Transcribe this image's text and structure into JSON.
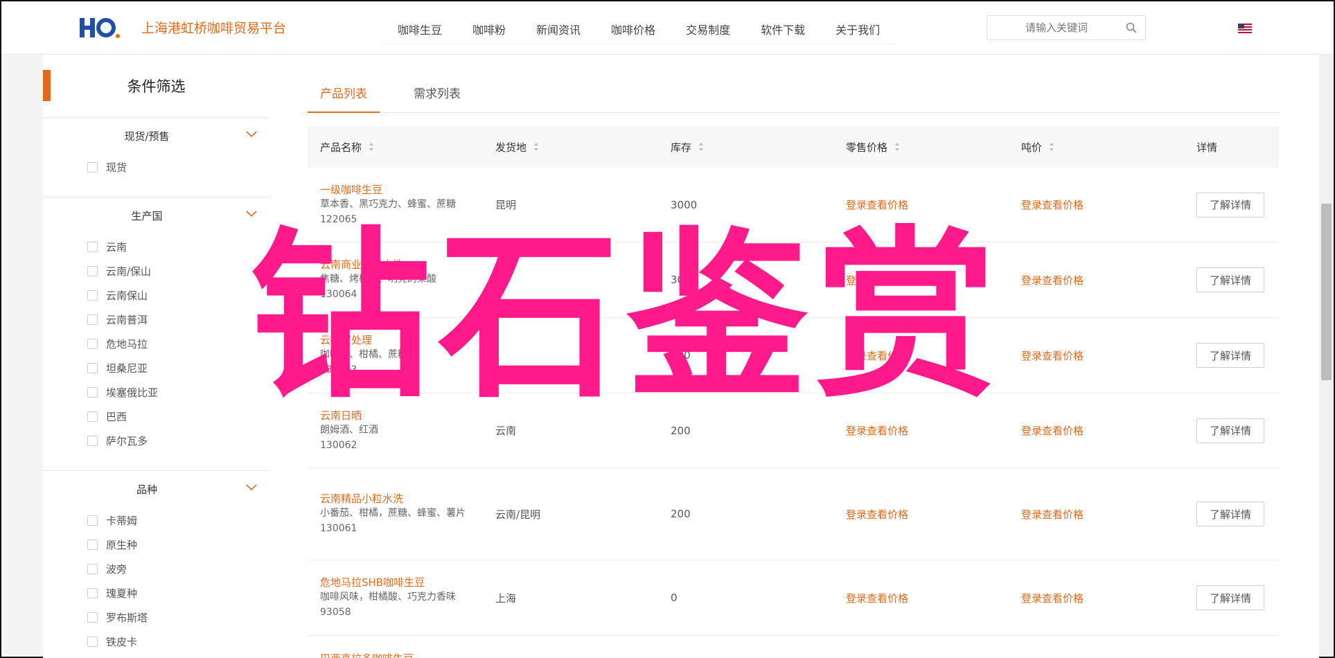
{
  "header": {
    "brand": "上海港虹桥咖啡贸易平台",
    "nav": [
      "咖啡生豆",
      "咖啡粉",
      "新闻资讯",
      "咖啡价格",
      "交易制度",
      "软件下载",
      "关于我们"
    ],
    "search_placeholder": "请输入关键词"
  },
  "sidebar": {
    "title": "条件筛选",
    "groups": [
      {
        "label": "现货/预售",
        "options": [
          "现货"
        ]
      },
      {
        "label": "生产国",
        "options": [
          "云南",
          "云南/保山",
          "云南保山",
          "云南普洱",
          "危地马拉",
          "坦桑尼亚",
          "埃塞俄比亚",
          "巴西",
          "萨尔瓦多"
        ]
      },
      {
        "label": "品种",
        "options": [
          "卡蒂姆",
          "原生种",
          "波旁",
          "瑰夏种",
          "罗布斯塔",
          "铁皮卡"
        ]
      }
    ]
  },
  "tabs": [
    "产品列表",
    "需求列表"
  ],
  "table": {
    "headers": [
      "产品名称",
      "发货地",
      "库存",
      "零售价格",
      "吨价",
      "详情"
    ],
    "rows": [
      {
        "name": "一级咖啡生豆",
        "desc": "草本香、黑巧克力、蜂蜜、蔗糖",
        "code": "122065",
        "origin": "昆明",
        "stock": "3000",
        "retail": "登录查看价格",
        "ton": "登录查看价格",
        "action": "了解详情"
      },
      {
        "name": "云南商业一级水洗",
        "desc": "焦糖、烤榛子、明亮的果酸",
        "code": "130064",
        "origin": "",
        "stock": "3000",
        "retail": "登录查看价格",
        "ton": "登录查看价格",
        "action": "了解详情"
      },
      {
        "name": "云南蜜处理",
        "desc": "咖啡花、柑橘、蔗糖",
        "code": "130063",
        "origin": "",
        "stock": "200",
        "retail": "登录查看价格",
        "ton": "登录查看价格",
        "action": "了解详情"
      },
      {
        "name": "云南日晒",
        "desc": "朗姆酒、红酒",
        "code": "130062",
        "origin": "云南",
        "stock": "200",
        "retail": "登录查看价格",
        "ton": "登录查看价格",
        "action": "了解详情"
      },
      {
        "name": "云南精品小粒水洗",
        "desc": "小番茄、柑橘，蔗糖、蜂蜜、薯片",
        "code": "130061",
        "origin": "云南/昆明",
        "stock": "200",
        "retail": "登录查看价格",
        "ton": "登录查看价格",
        "action": "了解详情"
      },
      {
        "name": "危地马拉SHB咖啡生豆",
        "desc": "咖啡风味，柑橘酸、巧克力香味",
        "code": "93058",
        "origin": "上海",
        "stock": "0",
        "retail": "登录查看价格",
        "ton": "登录查看价格",
        "action": "了解详情"
      },
      {
        "name": "巴西喜拉多咖啡生豆",
        "desc": "",
        "code": "",
        "origin": "",
        "stock": "",
        "retail": "",
        "ton": "",
        "action": ""
      }
    ]
  },
  "watermark": "钻石鉴赏",
  "colors": {
    "accent": "#e06a1c",
    "watermark": "#ff1a8c"
  }
}
